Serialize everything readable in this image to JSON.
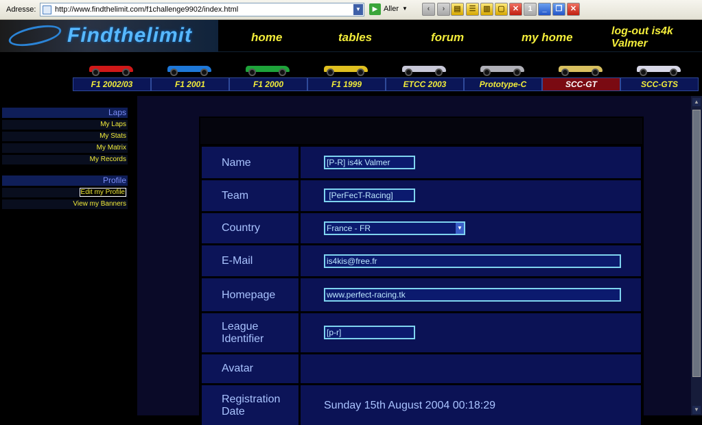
{
  "browser": {
    "address_label": "Adresse:",
    "url": "http://www.findthelimit.com/f1challenge9902/index.html",
    "go_label": "Aller",
    "toolbar_badge": "1"
  },
  "header": {
    "logo_text": "Findthelimit",
    "nav": [
      "home",
      "tables",
      "forum",
      "my home"
    ],
    "logout": "log-out is4k Valmer"
  },
  "categories": [
    {
      "label": "F1 2002/03",
      "color": "#d01818",
      "active": false
    },
    {
      "label": "F1 2001",
      "color": "#1e78d8",
      "active": false
    },
    {
      "label": "F1 2000",
      "color": "#1ea33a",
      "active": false
    },
    {
      "label": "F1 1999",
      "color": "#e0c020",
      "active": false
    },
    {
      "label": "ETCC 2003",
      "color": "#c8c8d8",
      "active": false
    },
    {
      "label": "Prototype-C",
      "color": "#b0b0b8",
      "active": false
    },
    {
      "label": "SCC-GT",
      "color": "#d8c060",
      "active": true
    },
    {
      "label": "SCC-GTS",
      "color": "#d8d8e8",
      "active": false
    }
  ],
  "sidebar": {
    "laps_heading": "Laps",
    "laps_items": [
      "My Laps",
      "My Stats",
      "My Matrix",
      "My Records"
    ],
    "profile_heading": "Profile",
    "profile_items": [
      "Edit my Profile",
      "View my Banners"
    ]
  },
  "profile": {
    "name_label": "Name",
    "name_value": "[P-R] is4k Valmer",
    "team_label": "Team",
    "team_value": " [PerFecT-Racing]",
    "country_label": "Country",
    "country_value": "France - FR",
    "email_label": "E-Mail",
    "email_value": "is4kis@free.fr",
    "homepage_label": "Homepage",
    "homepage_value": "www.perfect-racing.tk",
    "league_label": "League Identifier",
    "league_value": "[p-r]",
    "avatar_label": "Avatar",
    "registration_label": "Registration Date",
    "registration_value": "Sunday 15th August 2004 00:18:29"
  }
}
